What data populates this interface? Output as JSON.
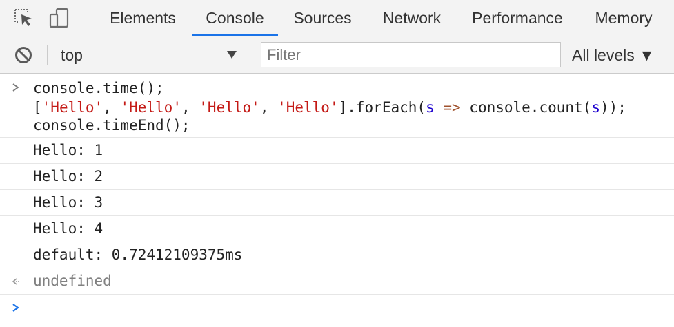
{
  "tabbar": {
    "inspect_icon": "inspect-element-icon",
    "device_icon": "device-toolbar-icon",
    "tabs": [
      {
        "label": "Elements"
      },
      {
        "label": "Console"
      },
      {
        "label": "Sources"
      },
      {
        "label": "Network"
      },
      {
        "label": "Performance"
      },
      {
        "label": "Memory"
      }
    ],
    "active_tab": "Console",
    "accent_color": "#1a73e8"
  },
  "toolbar": {
    "clear_icon": "clear-console-icon",
    "context": "top",
    "filter_placeholder": "Filter",
    "filter_value": "",
    "levels": "All levels ▼"
  },
  "console": {
    "input": {
      "line1": "console.time();",
      "line2_open": "[",
      "str1": "'Hello'",
      "str2": "'Hello'",
      "str3": "'Hello'",
      "str4": "'Hello'",
      "sep": ", ",
      "line2_close": "].forEach(",
      "param": "s",
      "arrow": "=>",
      "call": " console.count(",
      "arg": "s",
      "end": "));",
      "line3": "console.timeEnd();"
    },
    "logs": [
      "Hello: 1",
      "Hello: 2",
      "Hello: 3",
      "Hello: 4",
      "default: 0.72412109375ms"
    ],
    "result": "undefined"
  }
}
